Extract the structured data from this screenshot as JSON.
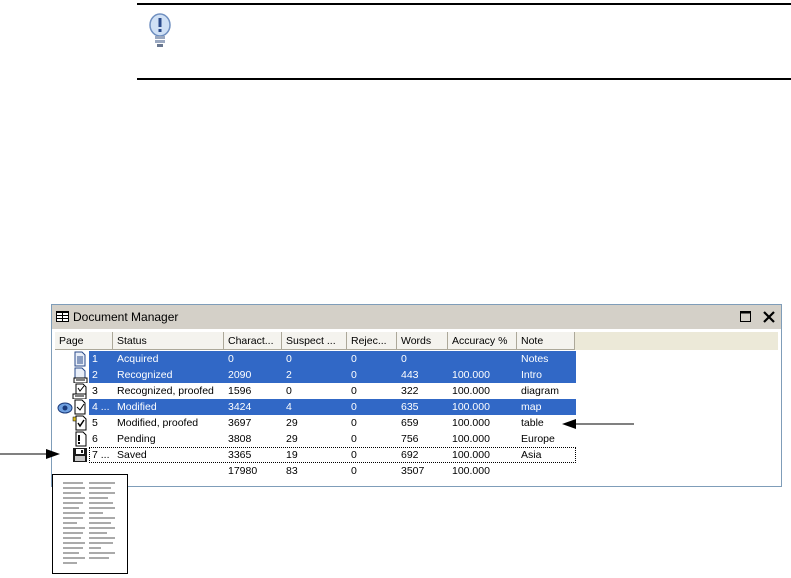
{
  "window": {
    "title": "Document Manager"
  },
  "table": {
    "columns": [
      "Page",
      "Status",
      "Charact...",
      "Suspect ...",
      "Rejec...",
      "Words",
      "Accuracy %",
      "Note"
    ],
    "rows": [
      {
        "page": "1",
        "status": "Acquired",
        "chars": "0",
        "suspect": "0",
        "rejected": "0",
        "words": "0",
        "accuracy": "",
        "note": "Notes",
        "selected": true,
        "icon": "page-acquired-icon"
      },
      {
        "page": "2",
        "status": "Recognized",
        "chars": "2090",
        "suspect": "2",
        "rejected": "0",
        "words": "443",
        "accuracy": "100.000",
        "note": "Intro",
        "selected": true,
        "icon": "page-recognized-icon"
      },
      {
        "page": "3",
        "status": "Recognized, proofed",
        "chars": "1596",
        "suspect": "0",
        "rejected": "0",
        "words": "322",
        "accuracy": "100.000",
        "note": "diagram",
        "selected": false,
        "icon": "page-proofed-icon"
      },
      {
        "page": "4 ...",
        "status": "Modified",
        "chars": "3424",
        "suspect": "4",
        "rejected": "0",
        "words": "635",
        "accuracy": "100.000",
        "note": "map",
        "selected": true,
        "icon": "page-modified-icon"
      },
      {
        "page": "5",
        "status": "Modified, proofed",
        "chars": "3697",
        "suspect": "29",
        "rejected": "0",
        "words": "659",
        "accuracy": "100.000",
        "note": "table",
        "selected": false,
        "icon": "page-modified-proofed-icon"
      },
      {
        "page": "6",
        "status": "Pending",
        "chars": "3808",
        "suspect": "29",
        "rejected": "0",
        "words": "756",
        "accuracy": "100.000",
        "note": "Europe",
        "selected": false,
        "icon": "page-pending-icon"
      },
      {
        "page": "7 ...",
        "status": "Saved",
        "chars": "3365",
        "suspect": "19",
        "rejected": "0",
        "words": "692",
        "accuracy": "100.000",
        "note": "Asia",
        "selected": false,
        "icon": "page-saved-icon"
      }
    ],
    "totals": {
      "chars": "17980",
      "suspect": "83",
      "rejected": "0",
      "words": "3507",
      "accuracy": "100.000"
    }
  }
}
